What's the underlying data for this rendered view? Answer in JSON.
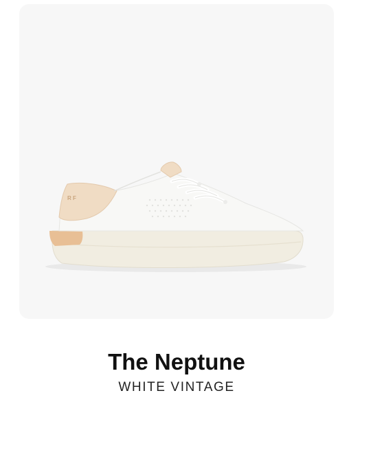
{
  "product": {
    "name": "The Neptune",
    "color_name": "WHITE VINTAGE",
    "image_alt_icon": "sneaker-image"
  },
  "palette": {
    "image_background": "#f7f7f7",
    "upper": "#f8f8f6",
    "heel_tab": "#f0dcc4",
    "sole": "#f1ede1",
    "accent": "#e8bf95",
    "title_text": "#111111",
    "subtitle_text": "#222222"
  }
}
